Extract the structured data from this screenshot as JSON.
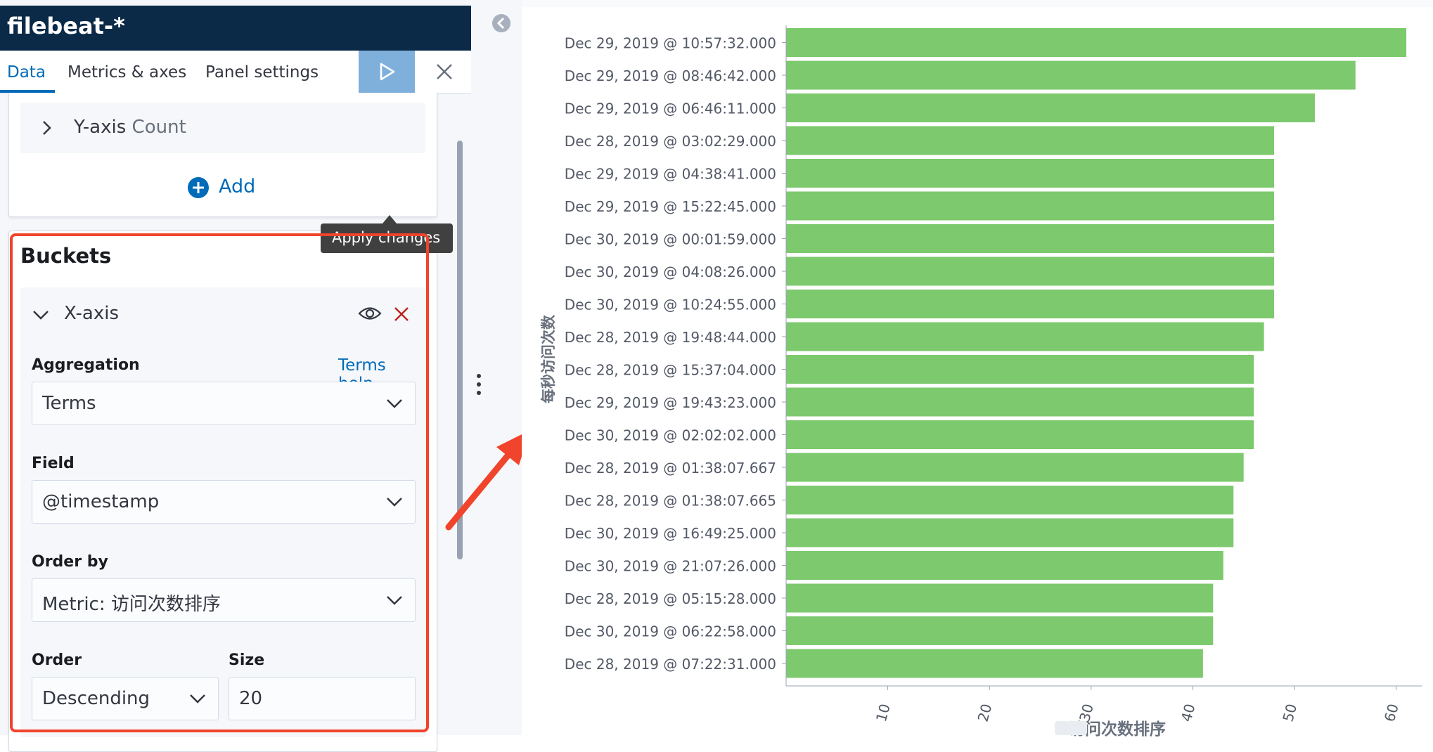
{
  "header": {
    "title": "filebeat-*"
  },
  "tabs": [
    {
      "label": "Data"
    },
    {
      "label": "Metrics & axes"
    },
    {
      "label": "Panel settings"
    }
  ],
  "toolbar": {
    "apply_tooltip": "Apply changes"
  },
  "metrics": {
    "yaxis_label": "Y-axis",
    "yaxis_agg": "Count",
    "add_label": "Add"
  },
  "buckets": {
    "title": "Buckets",
    "xaxis_label": "X-axis",
    "aggregation_label": "Aggregation",
    "help_label": "Terms help",
    "aggregation_value": "Terms",
    "field_label": "Field",
    "field_value": "@timestamp",
    "order_by_label": "Order by",
    "order_by_value": "Metric: 访问次数排序",
    "order_label": "Order",
    "order_value": "Descending",
    "size_label": "Size",
    "size_value": "20"
  },
  "colors": {
    "bar": "#7dc96d",
    "accent": "#006bb8",
    "annotation": "#f0442c"
  },
  "chart_data": {
    "type": "bar",
    "orientation": "horizontal",
    "categories": [
      "Dec 29, 2019 @ 10:57:32.000",
      "Dec 29, 2019 @ 08:46:42.000",
      "Dec 29, 2019 @ 06:46:11.000",
      "Dec 28, 2019 @ 03:02:29.000",
      "Dec 29, 2019 @ 04:38:41.000",
      "Dec 29, 2019 @ 15:22:45.000",
      "Dec 30, 2019 @ 00:01:59.000",
      "Dec 30, 2019 @ 04:08:26.000",
      "Dec 30, 2019 @ 10:24:55.000",
      "Dec 28, 2019 @ 19:48:44.000",
      "Dec 28, 2019 @ 15:37:04.000",
      "Dec 29, 2019 @ 19:43:23.000",
      "Dec 30, 2019 @ 02:02:02.000",
      "Dec 28, 2019 @ 01:38:07.667",
      "Dec 28, 2019 @ 01:38:07.665",
      "Dec 30, 2019 @ 16:49:25.000",
      "Dec 30, 2019 @ 21:07:26.000",
      "Dec 28, 2019 @ 05:15:28.000",
      "Dec 30, 2019 @ 06:22:58.000",
      "Dec 28, 2019 @ 07:22:31.000"
    ],
    "values": [
      61,
      56,
      52,
      48,
      48,
      48,
      48,
      48,
      48,
      47,
      46,
      46,
      46,
      45,
      44,
      44,
      43,
      42,
      42,
      41
    ],
    "xlabel": "访问次数排序",
    "ylabel": "每秒访问次数",
    "xlim": [
      0,
      62
    ],
    "xticks": [
      10,
      20,
      30,
      40,
      50,
      60
    ],
    "grid": false,
    "legend": "none"
  }
}
